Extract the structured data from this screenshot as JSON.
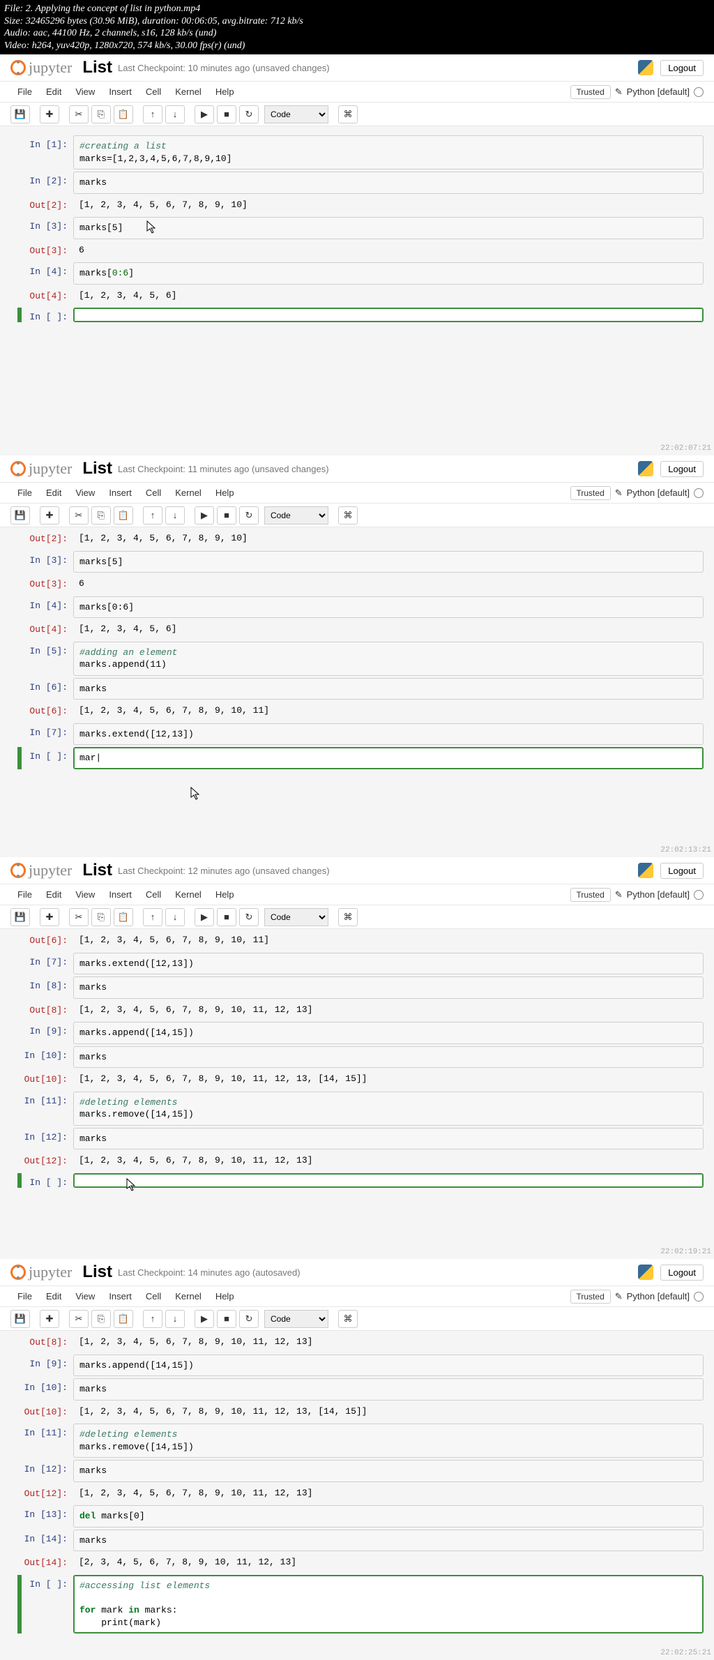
{
  "terminal": {
    "l1": "File: 2. Applying the concept of list in python.mp4",
    "l2": "Size: 32465296 bytes (30.96 MiB), duration: 00:06:05, avg.bitrate: 712 kb/s",
    "l3": "Audio: aac, 44100 Hz, 2 channels, s16, 128 kb/s (und)",
    "l4": "Video: h264, yuv420p, 1280x720, 574 kb/s, 30.00 fps(r) (und)"
  },
  "common": {
    "logo": "jupyter",
    "title": "List",
    "logout": "Logout",
    "trusted": "Trusted",
    "kernel": "Python [default]",
    "menus": {
      "file": "File",
      "edit": "Edit",
      "view": "View",
      "insert": "Insert",
      "cell": "Cell",
      "kernel": "Kernel",
      "help": "Help"
    },
    "celltype": "Code",
    "icons": {
      "save": "💾",
      "plus": "✚",
      "cut": "✂",
      "copy": "⎘",
      "paste": "📋",
      "up": "↑",
      "down": "↓",
      "run": "▶",
      "stop": "■",
      "restart": "↻",
      "cmd": "⌘",
      "pencil": "✎"
    }
  },
  "inst1": {
    "checkpoint": "Last Checkpoint: 10 minutes ago (unsaved changes)",
    "ts": "22:02:07:21",
    "c1_p": "In [1]:",
    "c1_a": "#creating a list",
    "c1_b": "marks=[1,2,3,4,5,6,7,8,9,10]",
    "c2_p": "In [2]:",
    "c2": "marks",
    "o2_p": "Out[2]:",
    "o2": "[1, 2, 3, 4, 5, 6, 7, 8, 9, 10]",
    "c3_p": "In [3]:",
    "c3": "marks[5]",
    "o3_p": "Out[3]:",
    "o3": "6",
    "c4_p": "In [4]:",
    "c4_a": "marks[",
    "c4_b": "0:6",
    "c4_c": "]",
    "o4_p": "Out[4]:",
    "o4": "[1, 2, 3, 4, 5, 6]",
    "c5_p": "In [ ]:",
    "c5": ""
  },
  "inst2": {
    "checkpoint": "Last Checkpoint: 11 minutes ago (unsaved changes)",
    "ts": "22:02:13:21",
    "o2_p": "Out[2]:",
    "o2": "[1, 2, 3, 4, 5, 6, 7, 8, 9, 10]",
    "c3_p": "In [3]:",
    "c3": "marks[5]",
    "o3_p": "Out[3]:",
    "o3": "6",
    "c4_p": "In [4]:",
    "c4": "marks[0:6]",
    "o4_p": "Out[4]:",
    "o4": "[1, 2, 3, 4, 5, 6]",
    "c5_p": "In [5]:",
    "c5_a": "#adding an element",
    "c5_b": "marks.append(11)",
    "c6_p": "In [6]:",
    "c6": "marks",
    "o6_p": "Out[6]:",
    "o6": "[1, 2, 3, 4, 5, 6, 7, 8, 9, 10, 11]",
    "c7_p": "In [7]:",
    "c7": "marks.extend([12,13])",
    "c8_p": "In [ ]:",
    "c8": "mar|"
  },
  "inst3": {
    "checkpoint": "Last Checkpoint: 12 minutes ago (unsaved changes)",
    "ts": "22:02:19:21",
    "o6_p": "Out[6]:",
    "o6": "[1, 2, 3, 4, 5, 6, 7, 8, 9, 10, 11]",
    "c7_p": "In [7]:",
    "c7": "marks.extend([12,13])",
    "c8_p": "In [8]:",
    "c8": "marks",
    "o8_p": "Out[8]:",
    "o8": "[1, 2, 3, 4, 5, 6, 7, 8, 9, 10, 11, 12, 13]",
    "c9_p": "In [9]:",
    "c9": "marks.append([14,15])",
    "c10_p": "In [10]:",
    "c10": "marks",
    "o10_p": "Out[10]:",
    "o10": "[1, 2, 3, 4, 5, 6, 7, 8, 9, 10, 11, 12, 13, [14, 15]]",
    "c11_p": "In [11]:",
    "c11_a": "#deleting elements",
    "c11_b": "marks.remove([14,15])",
    "c12_p": "In [12]:",
    "c12": "marks",
    "o12_p": "Out[12]:",
    "o12": "[1, 2, 3, 4, 5, 6, 7, 8, 9, 10, 11, 12, 13]",
    "c13_p": "In [ ]:",
    "c13": ""
  },
  "inst4": {
    "checkpoint": "Last Checkpoint: 14 minutes ago (autosaved)",
    "ts": "22:02:25:21",
    "o8_p": "Out[8]:",
    "o8": "[1, 2, 3, 4, 5, 6, 7, 8, 9, 10, 11, 12, 13]",
    "c9_p": "In [9]:",
    "c9": "marks.append([14,15])",
    "c10_p": "In [10]:",
    "c10": "marks",
    "o10_p": "Out[10]:",
    "o10": "[1, 2, 3, 4, 5, 6, 7, 8, 9, 10, 11, 12, 13, [14, 15]]",
    "c11_p": "In [11]:",
    "c11_a": "#deleting elements",
    "c11_b": "marks.remove([14,15])",
    "c12_p": "In [12]:",
    "c12": "marks",
    "o12_p": "Out[12]:",
    "o12": "[1, 2, 3, 4, 5, 6, 7, 8, 9, 10, 11, 12, 13]",
    "c13_p": "In [13]:",
    "c13_a": "del",
    "c13_b": " marks[0]",
    "c14_p": "In [14]:",
    "c14": "marks",
    "o14_p": "Out[14]:",
    "o14": "[2, 3, 4, 5, 6, 7, 8, 9, 10, 11, 12, 13]",
    "c15_p": "In [ ]:",
    "c15_a": "#accessing list elements",
    "c15_b": "for",
    "c15_c": " mark ",
    "c15_d": "in",
    "c15_e": " marks:",
    "c15_f": "    print(mark)"
  }
}
